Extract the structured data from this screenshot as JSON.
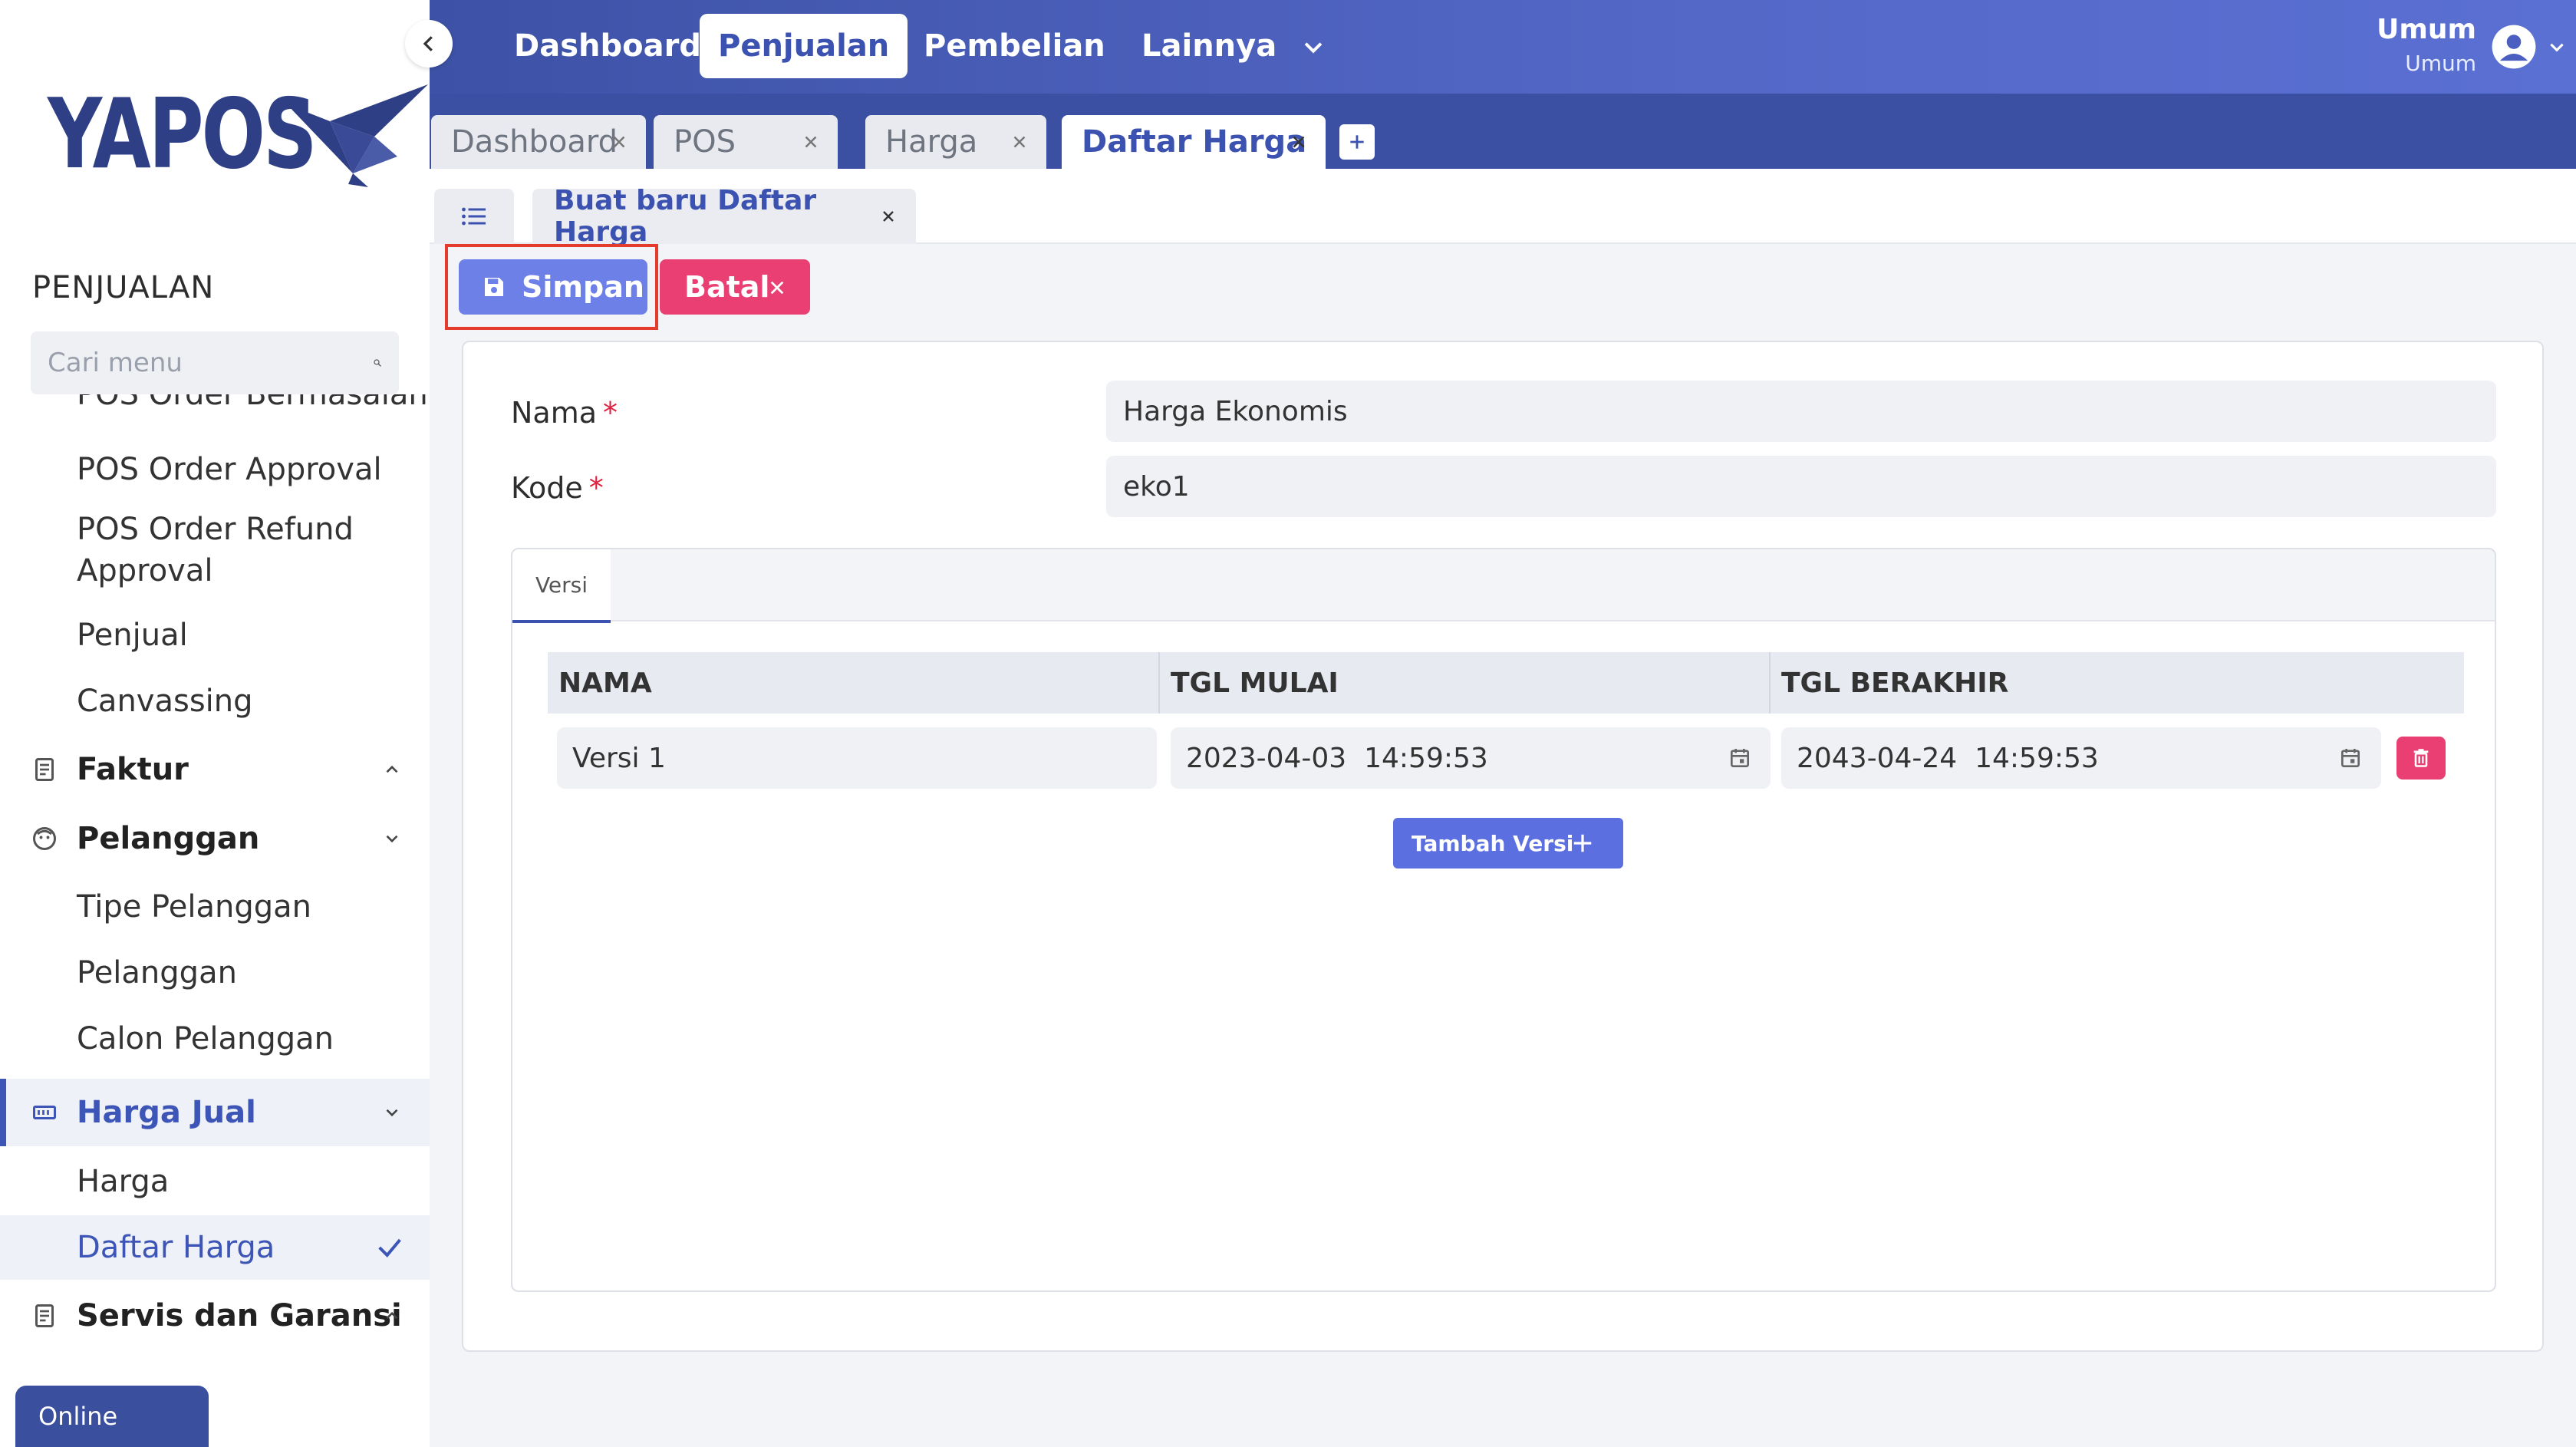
{
  "brand": {
    "name": "YAPOS",
    "color": "#2f3f85"
  },
  "sidebar": {
    "section_title": "PENJUALAN",
    "search_placeholder": "Cari menu",
    "partial_item": "POS Order Bermasalah",
    "items": [
      {
        "label": "POS Order Approval",
        "type": "sub"
      },
      {
        "label": "POS Order Refund Approval",
        "type": "sub"
      },
      {
        "label": "Penjual",
        "type": "sub"
      },
      {
        "label": "Canvassing",
        "type": "sub"
      },
      {
        "label": "Faktur",
        "type": "group",
        "icon": "receipt-icon",
        "expanded": false
      },
      {
        "label": "Pelanggan",
        "type": "group",
        "icon": "face-icon",
        "expanded": true
      },
      {
        "label": "Tipe Pelanggan",
        "type": "sub"
      },
      {
        "label": "Pelanggan",
        "type": "sub"
      },
      {
        "label": "Calon Pelanggan",
        "type": "sub"
      },
      {
        "label": "Harga Jual",
        "type": "group",
        "icon": "price-tag-icon",
        "expanded": true,
        "active": true
      },
      {
        "label": "Harga",
        "type": "sub"
      },
      {
        "label": "Daftar Harga",
        "type": "sub",
        "active": true
      },
      {
        "label": "Servis dan Garansi",
        "type": "group",
        "icon": "receipt-icon",
        "expanded": false
      }
    ],
    "status": "Online"
  },
  "topnav": {
    "items": [
      "Dashboard",
      "Penjualan",
      "Pembelian",
      "Lainnya"
    ],
    "active": "Penjualan",
    "user": {
      "name": "Umum",
      "role": "Umum"
    },
    "accent": "#3d52a6"
  },
  "tabs": {
    "items": [
      "Dashboard",
      "POS",
      "Harga",
      "Daftar Harga"
    ],
    "active": "Daftar Harga"
  },
  "subtab": {
    "label": "Buat baru Daftar Harga"
  },
  "toolbar": {
    "save_label": "Simpan",
    "cancel_label": "Batal",
    "save_color": "#6c80e8",
    "cancel_color": "#ea3f73"
  },
  "form": {
    "nama_label": "Nama",
    "nama_value": "Harga Ekonomis",
    "kode_label": "Kode",
    "kode_value": "eko1",
    "required_mark": "*"
  },
  "panel": {
    "tab_label": "Versi",
    "columns": [
      "NAMA",
      "TGL MULAI",
      "TGL BERAKHIR"
    ],
    "rows": [
      {
        "nama": "Versi 1",
        "tgl_mulai": "2023-04-03  14:59:53",
        "tgl_berakhir": "2043-04-24  14:59:53"
      }
    ],
    "add_label": "Tambah Versi"
  }
}
